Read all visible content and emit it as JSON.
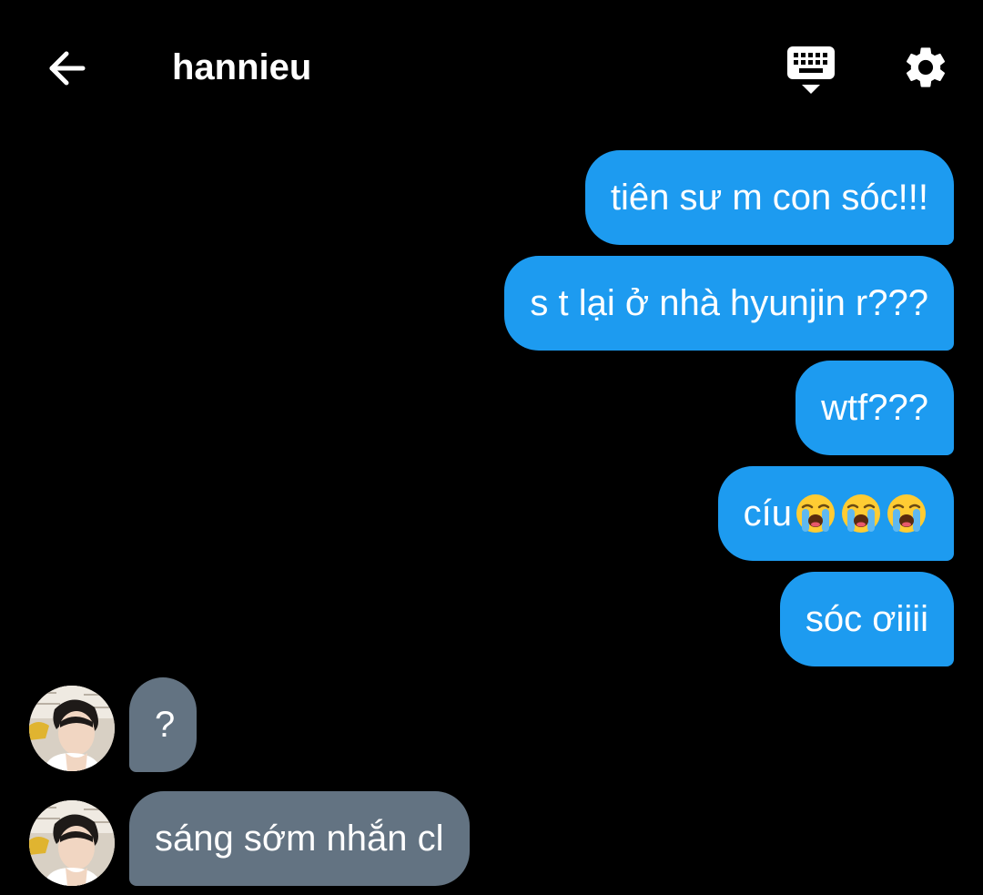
{
  "header": {
    "title": "hannieu",
    "back_icon": "arrow-left-icon",
    "keyboard_icon": "keyboard-hide-icon",
    "settings_icon": "gear-icon"
  },
  "colors": {
    "background": "#000000",
    "outgoing_bubble": "#1d9bf0",
    "incoming_bubble": "#637382",
    "text": "#ffffff"
  },
  "messages": {
    "outgoing": [
      {
        "text": "tiên sư m con sóc!!!"
      },
      {
        "text": "s t lại ở nhà hyunjin r???"
      },
      {
        "text": "wtf???"
      },
      {
        "text": "cíu",
        "emoji": [
          "loudly-crying-face-icon",
          "loudly-crying-face-icon",
          "loudly-crying-face-icon"
        ]
      },
      {
        "text": "sóc ơiiii"
      }
    ],
    "incoming": [
      {
        "text": "?"
      },
      {
        "text": "sáng sớm nhắn cl"
      }
    ]
  }
}
